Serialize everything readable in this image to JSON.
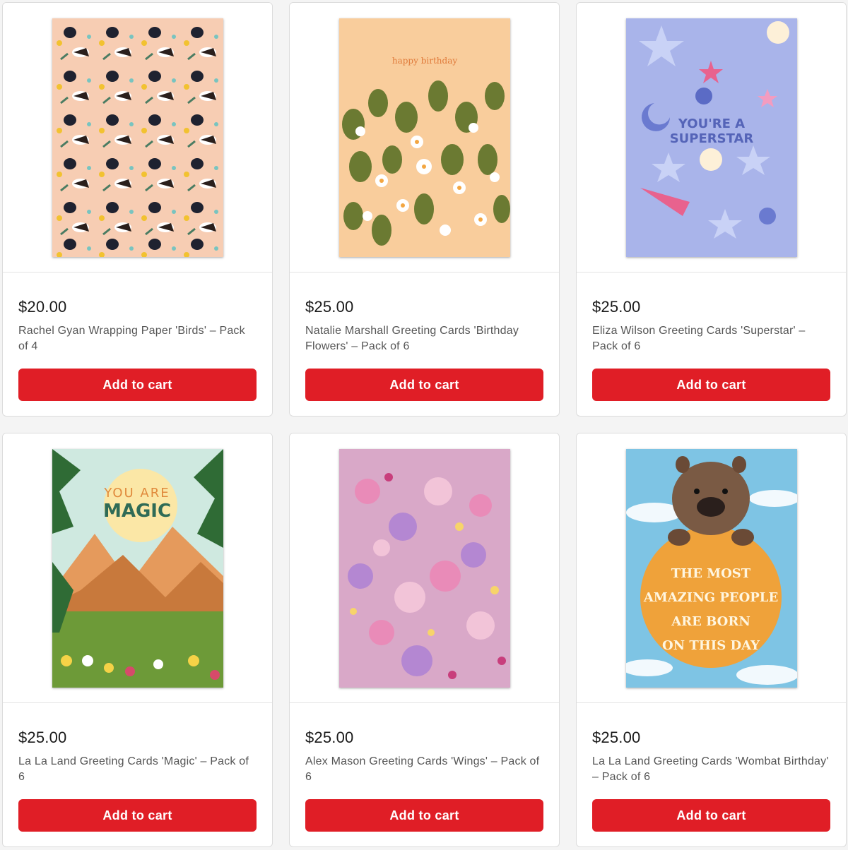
{
  "products": [
    {
      "price": "$20.00",
      "title": "Rachel Gyan Wrapping Paper 'Birds' – Pack of 4",
      "button": "Add to cart",
      "image_text": ""
    },
    {
      "price": "$25.00",
      "title": "Natalie Marshall Greeting Cards 'Birthday Flowers' – Pack of 6",
      "button": "Add to cart",
      "image_text": "happy birthday"
    },
    {
      "price": "$25.00",
      "title": "Eliza Wilson Greeting Cards 'Superstar' – Pack of 6",
      "button": "Add to cart",
      "image_text_line1": "YOU'RE A",
      "image_text_line2": "SUPERSTAR"
    },
    {
      "price": "$25.00",
      "title": "La La Land Greeting Cards 'Magic' – Pack of 6",
      "button": "Add to cart",
      "image_text_line1": "YOU ARE",
      "image_text_line2": "MAGIC"
    },
    {
      "price": "$25.00",
      "title": "Alex Mason Greeting Cards 'Wings' – Pack of 6",
      "button": "Add to cart",
      "image_text": ""
    },
    {
      "price": "$25.00",
      "title": "La La Land Greeting Cards 'Wombat Birthday' – Pack of 6",
      "button": "Add to cart",
      "image_text_line1": "THE MOST",
      "image_text_line2": "AMAZING PEOPLE",
      "image_text_line3": "ARE BORN",
      "image_text_line4": "ON THIS DAY"
    }
  ],
  "colors": {
    "button": "#e01e26",
    "button_text": "#ffffff",
    "price_text": "#1a1a1a",
    "title_text": "#555555"
  }
}
